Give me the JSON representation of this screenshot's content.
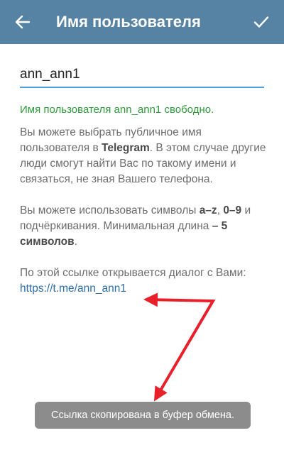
{
  "header": {
    "title": "Имя пользователя"
  },
  "username": {
    "value": "ann_ann1"
  },
  "status": {
    "text": "Имя пользователя ann_ann1 свободно."
  },
  "info1": {
    "before": "Вы можете выбрать публичное имя пользователя в ",
    "brand": "Telegram",
    "after": ". В этом случае другие люди смогут найти Вас по такому имени и связаться, не зная Вашего телефона."
  },
  "info2": {
    "before": "Вы можете использовать символы ",
    "letters": "a–z",
    "comma": ", ",
    "digits": "0–9",
    "middle": " и подчёркивания. Минимальная длина ",
    "minlen": "– 5 символов",
    "end": "."
  },
  "info3": {
    "text": "По этой ссылке открывается диалог с Вами:",
    "link": "https://t.me/ann_ann1"
  },
  "toast": {
    "text": "Ссылка скопирована в буфер обмена."
  },
  "colors": {
    "appbar": "#5682a3",
    "input_underline": "#4c9fe0",
    "status_green": "#2d9b3a",
    "link": "#2b6da8",
    "annotation_arrow": "#e8202a",
    "toast_bg": "#8c8c8c"
  },
  "icons": {
    "back": "arrow-left-icon",
    "confirm": "checkmark-icon"
  }
}
